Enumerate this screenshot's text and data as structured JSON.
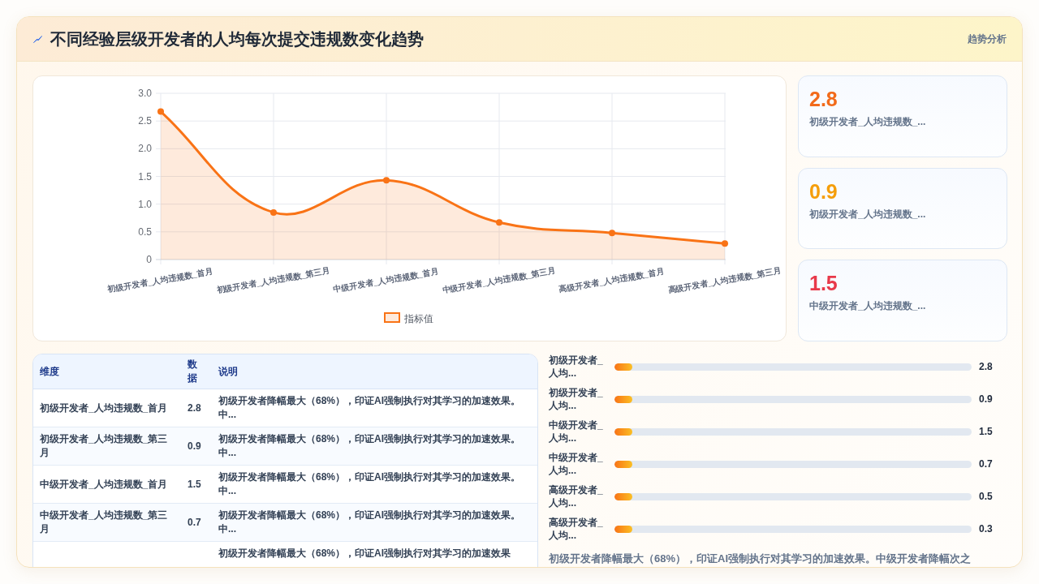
{
  "header": {
    "title": "不同经验层级开发者的人均每次提交违规数变化趋势",
    "tag": "趋势分析"
  },
  "chart": {
    "chart_data": {
      "type": "area",
      "grid": true,
      "categories": [
        "初级开发者_人均违规数_首月",
        "初级开发者_人均违规数_第三月",
        "中级开发者_人均违规数_首月",
        "中级开发者_人均违规数_第三月",
        "高级开发者_人均违规数_首月",
        "高级开发者_人均违规数_第三月"
      ],
      "series": [
        {
          "name": "指标值",
          "color": "#f97316",
          "values": [
            2.67,
            0.85,
            1.43,
            0.67,
            0.48,
            0.29
          ]
        }
      ],
      "ylim": [
        0,
        3
      ],
      "yticks": [
        {
          "value": 0,
          "label": "0"
        },
        {
          "value": 0.5,
          "label": "0.5"
        },
        {
          "value": 1,
          "label": "1.0"
        },
        {
          "value": 1.5,
          "label": "1.5"
        },
        {
          "value": 2,
          "label": "2.0"
        },
        {
          "value": 2.5,
          "label": "2.5"
        },
        {
          "value": 3,
          "label": "3.0"
        }
      ]
    }
  },
  "stat_cards": [
    {
      "value": "2.8",
      "label": "初级开发者_人均违规数_...",
      "color": "#f26b1a"
    },
    {
      "value": "0.9",
      "label": "初级开发者_人均违规数_...",
      "color": "#f59e0b"
    },
    {
      "value": "1.5",
      "label": "中级开发者_人均违规数_...",
      "color": "#e8394a"
    }
  ],
  "table": {
    "columns": [
      "维度",
      "数据",
      "说明"
    ],
    "rows": [
      {
        "dimension": "初级开发者_人均违规数_首月",
        "value": "2.8",
        "description": "初级开发者降幅最大（68%），印证AI强制执行对其学习的加速效果。中..."
      },
      {
        "dimension": "初级开发者_人均违规数_第三月",
        "value": "0.9",
        "description": "初级开发者降幅最大（68%），印证AI强制执行对其学习的加速效果。中..."
      },
      {
        "dimension": "中级开发者_人均违规数_首月",
        "value": "1.5",
        "description": "初级开发者降幅最大（68%），印证AI强制执行对其学习的加速效果。中..."
      },
      {
        "dimension": "中级开发者_人均违规数_第三月",
        "value": "0.7",
        "description": "初级开发者降幅最大（68%），印证AI强制执行对其学习的加速效果。中..."
      },
      {
        "description": "初级开发者降幅最大（68%），印证AI强制执行对其学习的加速效果"
      }
    ]
  },
  "bars": {
    "items": [
      {
        "label": "初级开发者_人均...",
        "level": 0.05,
        "value": "2.8"
      },
      {
        "label": "初级开发者_人均...",
        "level": 0.05,
        "value": "0.9"
      },
      {
        "label": "中级开发者_人均...",
        "level": 0.05,
        "value": "1.5"
      },
      {
        "label": "中级开发者_人均...",
        "level": 0.05,
        "value": "0.7"
      },
      {
        "label": "高级开发者_人均...",
        "level": 0.05,
        "value": "0.5"
      },
      {
        "label": "高级开发者_人均...",
        "level": 0.05,
        "value": "0.3"
      }
    ],
    "note": "初级开发者降幅最大（68%），印证AI强制执行对其学习的加速效果。中级开发者降幅次之"
  }
}
